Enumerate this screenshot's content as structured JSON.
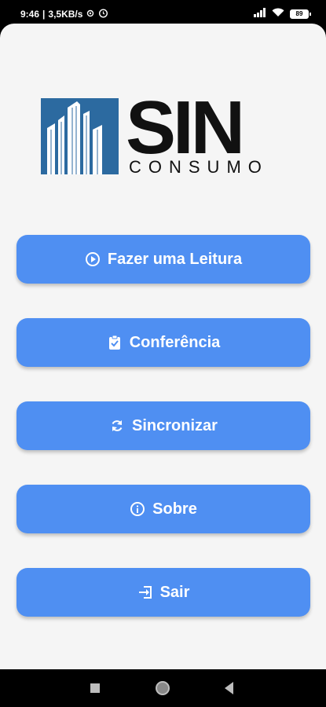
{
  "status_bar": {
    "time": "9:46",
    "network_speed": "3,5KB/s",
    "battery": "89",
    "icons": [
      "settings-icon",
      "alarm-icon",
      "signal-icon",
      "wifi-icon",
      "battery-icon"
    ]
  },
  "logo": {
    "title": "SIN",
    "subtitle": "CONSUMO",
    "brand_color": "#2c6aa0"
  },
  "menu": {
    "items": [
      {
        "label": "Fazer uma Leitura",
        "icon": "play-circle-icon"
      },
      {
        "label": "Conferência",
        "icon": "clipboard-check-icon"
      },
      {
        "label": "Sincronizar",
        "icon": "sync-icon"
      },
      {
        "label": "Sobre",
        "icon": "info-icon"
      },
      {
        "label": "Sair",
        "icon": "logout-icon"
      }
    ]
  },
  "colors": {
    "button": "#4f8ff2",
    "background": "#f5f5f5"
  },
  "nav_bar": {
    "buttons": [
      "recent-apps-icon",
      "home-icon",
      "back-icon"
    ]
  }
}
